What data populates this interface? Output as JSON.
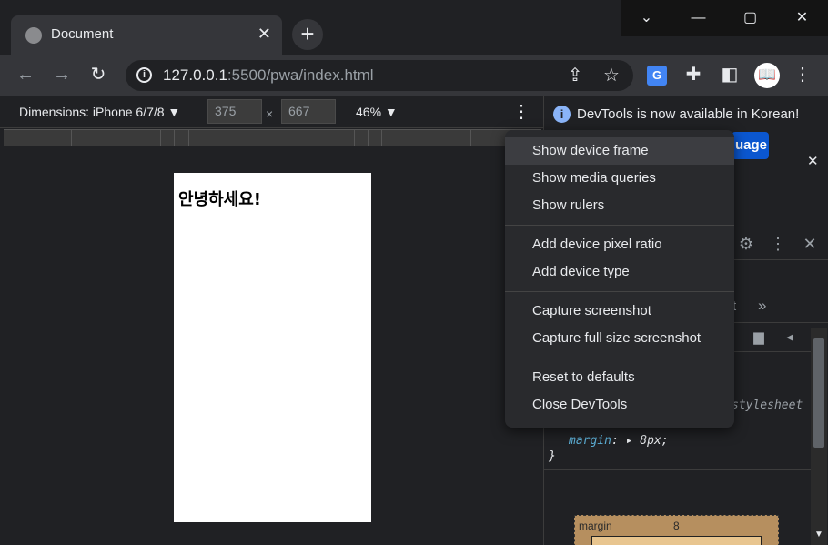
{
  "browser": {
    "tab_title": "Document",
    "tab_close": "✕",
    "new_tab": "+",
    "url_host": "127.0.0.1",
    "url_rest": ":5500/pwa/index.html",
    "ext_translate_label": "G",
    "window_minimize": "—",
    "window_maximize": "▢",
    "window_close": "✕",
    "tab_search": "⌄"
  },
  "device_toolbar": {
    "dimensions_label": "Dimensions: iPhone 6/7/8 ▼",
    "width": "375",
    "height": "667",
    "times": "×",
    "zoom": "46% ▼",
    "more": "⋮"
  },
  "page": {
    "heading": "안녕하세요!"
  },
  "devtools": {
    "info_icon": "i",
    "info_text": "DevTools is now available in Korean!",
    "lang_button": "uage",
    "banner_close": "✕",
    "tab_tail": "t",
    "tab_more": "»",
    "ua_source": "stylesheet",
    "css_property": "margin",
    "css_colon": ":",
    "css_arrow": "▸",
    "css_value": "8px;",
    "css_close_brace": "}",
    "boxmodel_label": "margin",
    "boxmodel_value": "8"
  },
  "context_menu": {
    "items": [
      "Show device frame",
      "Show media queries",
      "Show rulers",
      "Add device pixel ratio",
      "Add device type",
      "Capture screenshot",
      "Capture full size screenshot",
      "Reset to defaults",
      "Close DevTools"
    ]
  },
  "colors": {
    "menu_bg": "#292a2d",
    "menu_hover": "#3c3d41",
    "accent_blue": "#8ab4f8",
    "language_button": "#0b57d0"
  }
}
